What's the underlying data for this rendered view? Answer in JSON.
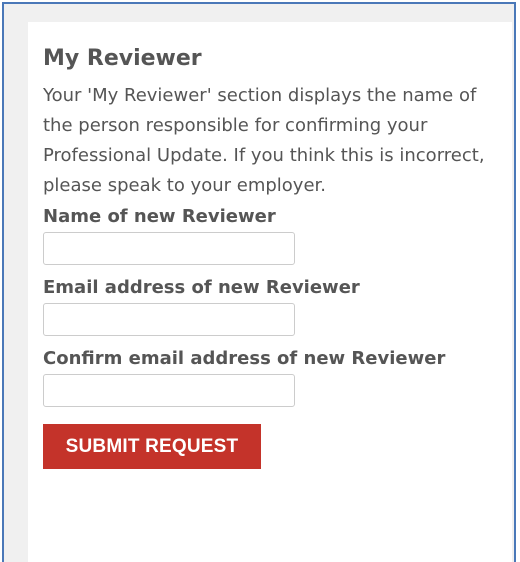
{
  "section": {
    "title": "My Reviewer",
    "description": "Your 'My Reviewer' section displays the name of the person responsible for confirming your Professional Update. If you think this is incorrect, please speak to your employer."
  },
  "form": {
    "name_label": "Name of new Reviewer",
    "name_value": "",
    "email_label": "Email address of new Reviewer",
    "email_value": "",
    "confirm_email_label": "Confirm email address of new Reviewer",
    "confirm_email_value": "",
    "submit_label": "SUBMIT REQUEST"
  },
  "colors": {
    "frame_border": "#4a78b8",
    "text": "#555555",
    "submit_background": "#c4332a",
    "submit_text": "#ffffff"
  }
}
